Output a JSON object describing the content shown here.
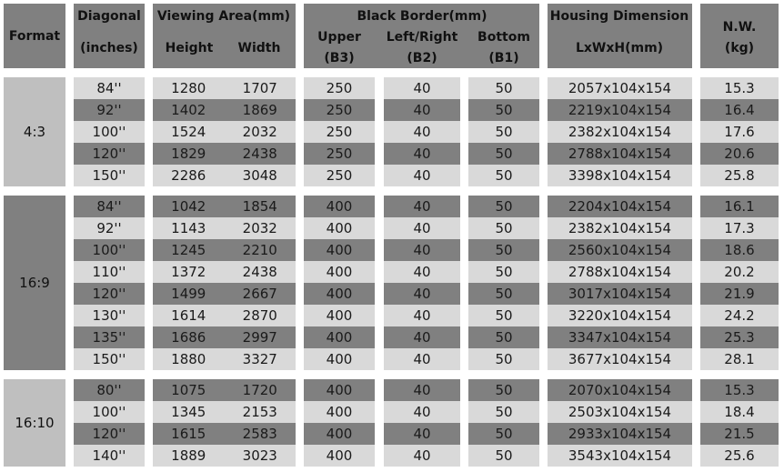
{
  "header": {
    "format": "Format",
    "diagonal_1": "Diagonal",
    "diagonal_2": "(inches)",
    "viewing_area": "Viewing Area(mm)",
    "height": "Height",
    "width": "Width",
    "black_border": "Black Border(mm)",
    "upper_1": "Upper",
    "upper_2": "(B3)",
    "leftright_1": "Left/Right",
    "leftright_2": "(B2)",
    "bottom_1": "Bottom",
    "bottom_2": "(B1)",
    "housing_1": "Housing Dimension",
    "housing_2": "LxWxH(mm)",
    "nw_1": "N.W.",
    "nw_2": "(kg)"
  },
  "colors": {
    "light": "#d9d9d9",
    "dark": "#808080",
    "format_light": "#bfbfbf"
  },
  "groups": [
    {
      "format": "4:3",
      "rows": [
        {
          "diagonal": "84''",
          "height": "1280",
          "width": "1707",
          "upper": "250",
          "leftright": "40",
          "bottom": "50",
          "housing": "2057x104x154",
          "nw": "15.3"
        },
        {
          "diagonal": "92''",
          "height": "1402",
          "width": "1869",
          "upper": "250",
          "leftright": "40",
          "bottom": "50",
          "housing": "2219x104x154",
          "nw": "16.4"
        },
        {
          "diagonal": "100''",
          "height": "1524",
          "width": "2032",
          "upper": "250",
          "leftright": "40",
          "bottom": "50",
          "housing": "2382x104x154",
          "nw": "17.6"
        },
        {
          "diagonal": "120''",
          "height": "1829",
          "width": "2438",
          "upper": "250",
          "leftright": "40",
          "bottom": "50",
          "housing": "2788x104x154",
          "nw": "20.6"
        },
        {
          "diagonal": "150''",
          "height": "2286",
          "width": "3048",
          "upper": "250",
          "leftright": "40",
          "bottom": "50",
          "housing": "3398x104x154",
          "nw": "25.8"
        }
      ]
    },
    {
      "format": "16:9",
      "rows": [
        {
          "diagonal": "84''",
          "height": "1042",
          "width": "1854",
          "upper": "400",
          "leftright": "40",
          "bottom": "50",
          "housing": "2204x104x154",
          "nw": "16.1"
        },
        {
          "diagonal": "92''",
          "height": "1143",
          "width": "2032",
          "upper": "400",
          "leftright": "40",
          "bottom": "50",
          "housing": "2382x104x154",
          "nw": "17.3"
        },
        {
          "diagonal": "100''",
          "height": "1245",
          "width": "2210",
          "upper": "400",
          "leftright": "40",
          "bottom": "50",
          "housing": "2560x104x154",
          "nw": "18.6"
        },
        {
          "diagonal": "110''",
          "height": "1372",
          "width": "2438",
          "upper": "400",
          "leftright": "40",
          "bottom": "50",
          "housing": "2788x104x154",
          "nw": "20.2"
        },
        {
          "diagonal": "120''",
          "height": "1499",
          "width": "2667",
          "upper": "400",
          "leftright": "40",
          "bottom": "50",
          "housing": "3017x104x154",
          "nw": "21.9"
        },
        {
          "diagonal": "130''",
          "height": "1614",
          "width": "2870",
          "upper": "400",
          "leftright": "40",
          "bottom": "50",
          "housing": "3220x104x154",
          "nw": "24.2"
        },
        {
          "diagonal": "135''",
          "height": "1686",
          "width": "2997",
          "upper": "400",
          "leftright": "40",
          "bottom": "50",
          "housing": "3347x104x154",
          "nw": "25.3"
        },
        {
          "diagonal": "150''",
          "height": "1880",
          "width": "3327",
          "upper": "400",
          "leftright": "40",
          "bottom": "50",
          "housing": "3677x104x154",
          "nw": "28.1"
        }
      ]
    },
    {
      "format": "16:10",
      "rows": [
        {
          "diagonal": "80''",
          "height": "1075",
          "width": "1720",
          "upper": "400",
          "leftright": "40",
          "bottom": "50",
          "housing": "2070x104x154",
          "nw": "15.3"
        },
        {
          "diagonal": "100''",
          "height": "1345",
          "width": "2153",
          "upper": "400",
          "leftright": "40",
          "bottom": "50",
          "housing": "2503x104x154",
          "nw": "18.4"
        },
        {
          "diagonal": "120''",
          "height": "1615",
          "width": "2583",
          "upper": "400",
          "leftright": "40",
          "bottom": "50",
          "housing": "2933x104x154",
          "nw": "21.5"
        },
        {
          "diagonal": "140''",
          "height": "1889",
          "width": "3023",
          "upper": "400",
          "leftright": "40",
          "bottom": "50",
          "housing": "3543x104x154",
          "nw": "25.6"
        }
      ]
    }
  ]
}
